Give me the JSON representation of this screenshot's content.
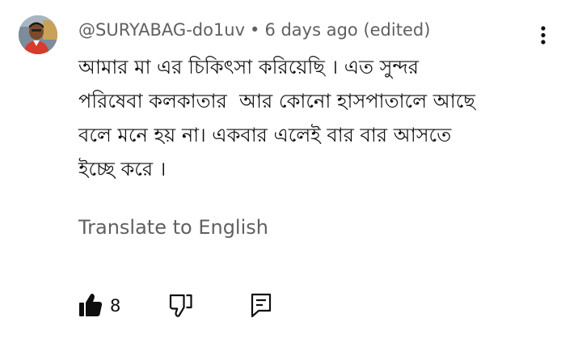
{
  "comment": {
    "author": "@SURYABAG-do1uv",
    "separator": "•",
    "timestamp": "6 days ago (edited)",
    "lines": [
      "আমার মা এর চিকিৎসা করিয়েছি । এত সুন্দর",
      "পরিষেবা কলকাতার  আর কোনো হাসপাতালে আছে",
      "বলে মনে হয় না। একবার এলেই বার বার আসতে",
      "ইচ্ছে করে ।"
    ],
    "translate_label": "Translate to English",
    "like_count": "8"
  },
  "icons": {
    "avatar": "user-avatar",
    "menu": "more-vertical-icon",
    "like": "thumbs-up-filled-icon",
    "dislike": "thumbs-down-outline-icon",
    "reply": "reply-comment-icon"
  },
  "colors": {
    "text": "#0f0f0f",
    "secondary_text": "#606060",
    "background": "#ffffff"
  }
}
